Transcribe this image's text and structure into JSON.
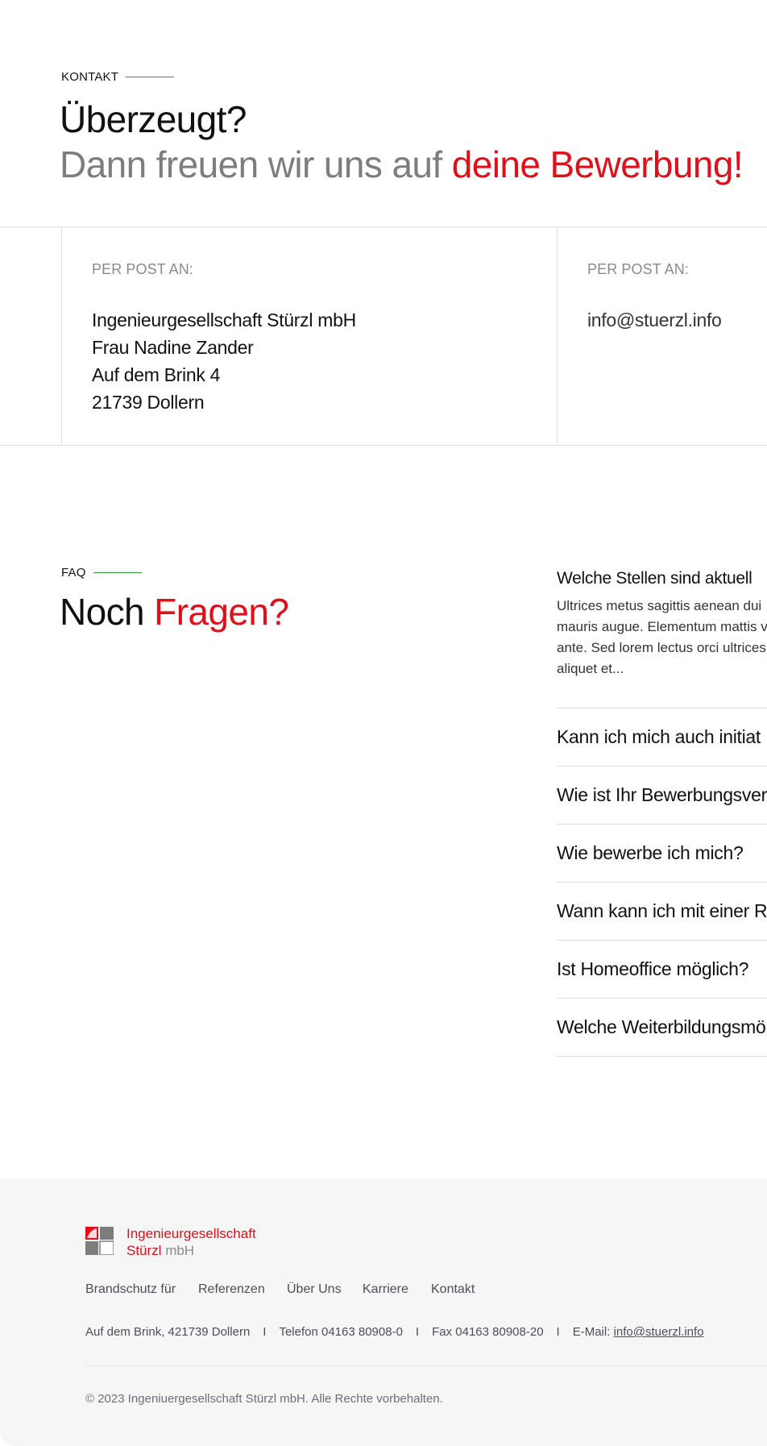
{
  "kontakt": {
    "eyebrow": "KONTAKT",
    "heading_line1": "Überzeugt?",
    "heading_line2_grey": "Dann freuen wir uns auf ",
    "heading_line2_red": "deine Bewerbung!",
    "card1": {
      "label": "PER POST AN:",
      "lines": [
        "Ingenieurgesellschaft Stürzl mbH",
        "Frau Nadine Zander",
        "Auf dem Brink 4",
        "21739 Dollern"
      ]
    },
    "card2": {
      "label": "PER POST AN:",
      "email": "info@stuerzl.info"
    },
    "accent_green": "#2e9b3c",
    "accent_red": "#e0101a"
  },
  "faq": {
    "eyebrow": "FAQ",
    "heading_black": "Noch ",
    "heading_red": "Fragen?",
    "open_item": {
      "question": "Welche Stellen sind aktuell",
      "answer_lines": [
        "Ultrices metus sagittis aenean dui",
        "mauris augue. Elementum mattis v",
        "ante. Sed lorem lectus orci ultrices",
        "aliquet et..."
      ]
    },
    "items": [
      "Kann ich mich auch initiat",
      "Wie ist Ihr Bewerbungsver",
      "Wie bewerbe ich mich?",
      "Wann kann ich mit einer R",
      "Ist Homeoffice möglich?",
      "Welche Weiterbildungsmö"
    ]
  },
  "footer": {
    "logo": {
      "line1": "Ingenieurgesellschaft",
      "line2_red": "Stürzl",
      "line2_grey": " mbH"
    },
    "nav": [
      "Brandschutz für",
      "Referenzen",
      "Über Uns",
      "Karriere",
      "Kontakt"
    ],
    "address": "Auf dem Brink, 421739 Dollern",
    "separator": "I",
    "phone": "Telefon 04163 80908-0",
    "fax": "Fax 04163 80908-20",
    "email_label": "E-Mail: ",
    "email": "info@stuerzl.info",
    "copyright": "© 2023 Ingeniuergesellschaft Stürzl mbH. Alle Rechte vorbehalten."
  }
}
